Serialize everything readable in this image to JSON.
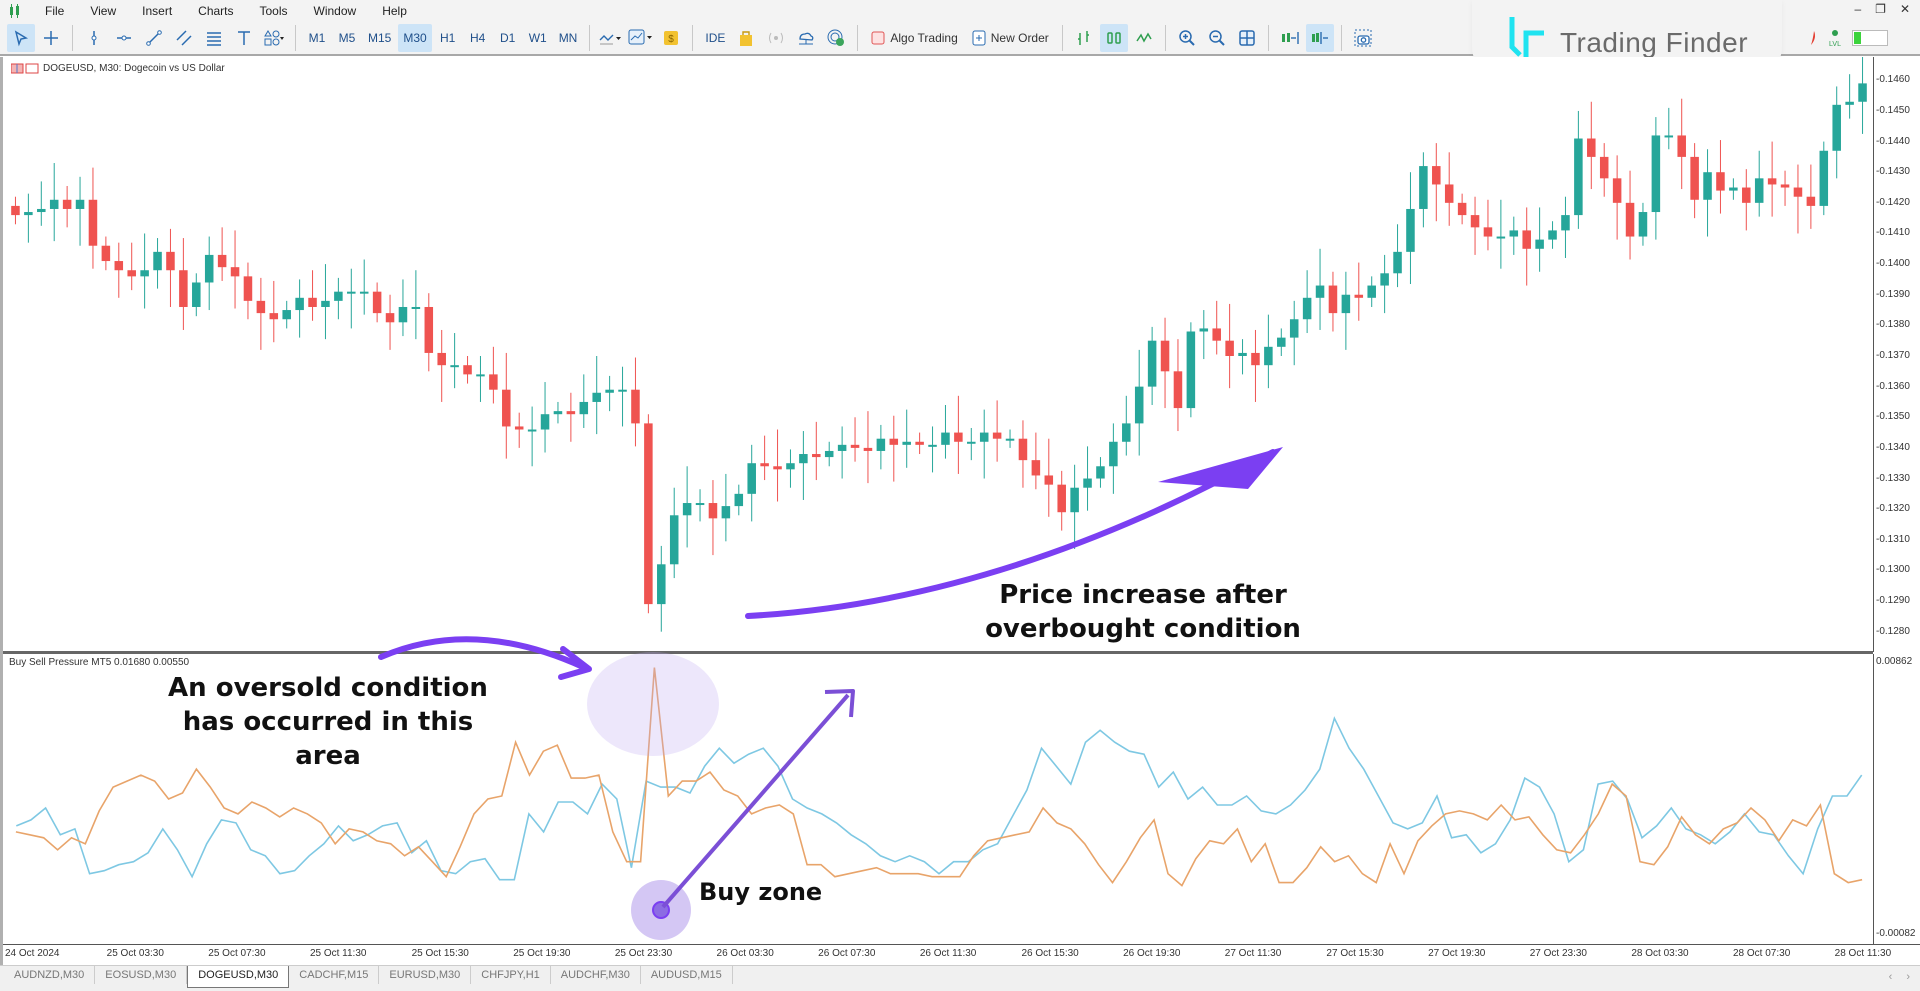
{
  "menu": {
    "items": [
      "File",
      "View",
      "Insert",
      "Charts",
      "Tools",
      "Window",
      "Help"
    ]
  },
  "window_controls": [
    "minimize-icon",
    "restore-icon",
    "close-icon"
  ],
  "toolbar": {
    "tool_icons": [
      "cursor-icon",
      "crosshair-icon",
      "vertical-line-icon",
      "horizontal-line-icon",
      "trendline-icon",
      "channel-icon",
      "fibonacci-icon",
      "text-icon",
      "shapes-icon"
    ],
    "timeframes": [
      "M1",
      "M5",
      "M15",
      "M30",
      "H1",
      "H4",
      "D1",
      "W1",
      "MN"
    ],
    "active_timeframe": "M30",
    "ide_label": "IDE",
    "algo_trading_label": "Algo Trading",
    "new_order_label": "New Order"
  },
  "logo": {
    "text": "Trading Finder",
    "accent": "#1fe3f0"
  },
  "chart": {
    "title": "DOGEUSD, M30:  Dogecoin vs US Dollar",
    "indicator_label": "Buy Sell Pressure MT5 0.01680 0.00550",
    "up_color": "#26a69a",
    "down_color": "#ef5350"
  },
  "annotations": {
    "oversold": [
      "An oversold condition",
      "has occurred in this",
      "area"
    ],
    "price_increase": [
      "Price increase after",
      "overbought condition"
    ],
    "buy_zone": "Buy zone",
    "arrow_color": "#7b3ff2"
  },
  "tabs": {
    "items": [
      "AUDNZD,M30",
      "EOSUSD,M30",
      "DOGEUSD,M30",
      "CADCHF,M15",
      "EURUSD,M30",
      "CHFJPY,H1",
      "AUDCHF,M30",
      "AUDUSD,M15"
    ],
    "active": "DOGEUSD,M30"
  },
  "chart_data": [
    {
      "type": "candlestick",
      "title": "DOGEUSD, M30: Dogecoin vs US Dollar",
      "ylim": [
        0.1275,
        0.1465
      ],
      "y_ticks": [
        "0.1460",
        "0.1450",
        "0.1440",
        "0.1430",
        "0.1420",
        "0.1410",
        "0.1400",
        "0.1390",
        "0.1380",
        "0.1370",
        "0.1360",
        "0.1350",
        "0.1340",
        "0.1330",
        "0.1320",
        "0.1310",
        "0.1300",
        "0.1290",
        "0.1280"
      ],
      "x_ticks": [
        "24 Oct 2024",
        "25 Oct 03:30",
        "25 Oct 07:30",
        "25 Oct 11:30",
        "25 Oct 15:30",
        "25 Oct 19:30",
        "25 Oct 23:30",
        "26 Oct 03:30",
        "26 Oct 07:30",
        "26 Oct 11:30",
        "26 Oct 15:30",
        "26 Oct 19:30",
        "27 Oct 11:30",
        "27 Oct 15:30",
        "27 Oct 19:30",
        "27 Oct 23:30",
        "28 Oct 03:30",
        "28 Oct 07:30",
        "28 Oct 11:30"
      ],
      "close": [
        0.1416,
        0.1417,
        0.1418,
        0.1421,
        0.1418,
        0.1421,
        0.1406,
        0.1401,
        0.1398,
        0.1396,
        0.1398,
        0.1404,
        0.1398,
        0.1386,
        0.1394,
        0.1403,
        0.1399,
        0.1396,
        0.1388,
        0.1384,
        0.1382,
        0.1385,
        0.1389,
        0.1386,
        0.1388,
        0.1391,
        0.1391,
        0.1391,
        0.1384,
        0.1381,
        0.1386,
        0.1386,
        0.1371,
        0.1367,
        0.1367,
        0.1364,
        0.1364,
        0.1359,
        0.1347,
        0.1346,
        0.1346,
        0.1351,
        0.1352,
        0.1351,
        0.1355,
        0.1358,
        0.1359,
        0.1359,
        0.1348,
        0.1289,
        0.1302,
        0.1318,
        0.1322,
        0.1322,
        0.1317,
        0.1321,
        0.1325,
        0.1335,
        0.1334,
        0.1333,
        0.1335,
        0.1338,
        0.1337,
        0.1339,
        0.1341,
        0.134,
        0.1339,
        0.1343,
        0.1341,
        0.1342,
        0.1341,
        0.1341,
        0.1345,
        0.1342,
        0.1342,
        0.1345,
        0.1343,
        0.1343,
        0.1336,
        0.1331,
        0.1328,
        0.1319,
        0.1327,
        0.133,
        0.1334,
        0.1342,
        0.1348,
        0.136,
        0.1375,
        0.1365,
        0.1353,
        0.1378,
        0.1379,
        0.1375,
        0.137,
        0.1371,
        0.1367,
        0.1373,
        0.1376,
        0.1382,
        0.1389,
        0.1393,
        0.1384,
        0.139,
        0.1389,
        0.1393,
        0.1397,
        0.1404,
        0.1418,
        0.1432,
        0.1426,
        0.142,
        0.1416,
        0.1412,
        0.1409,
        0.1409,
        0.1411,
        0.1405,
        0.1408,
        0.1411,
        0.1416,
        0.1441,
        0.1435,
        0.1428,
        0.142,
        0.1409,
        0.1417,
        0.1442,
        0.1442,
        0.1435,
        0.1421,
        0.143,
        0.1424,
        0.1425,
        0.142,
        0.1428,
        0.1426,
        0.1425,
        0.1422,
        0.1419,
        0.1437,
        0.1452,
        0.1453,
        0.1459
      ]
    },
    {
      "type": "line",
      "title": "Buy Sell Pressure MT5 0.01680 0.00550",
      "ylim": [
        -0.00082,
        0.00862
      ],
      "y_ticks": [
        "0.00862",
        "-0.00082"
      ],
      "series": [
        {
          "name": "buy_pressure",
          "color": "#7ec8e3",
          "values": [
            0.003,
            0.0032,
            0.0036,
            0.0027,
            0.0029,
            0.0014,
            0.0015,
            0.0017,
            0.0018,
            0.0021,
            0.0029,
            0.0022,
            0.0013,
            0.0024,
            0.0032,
            0.0031,
            0.0022,
            0.002,
            0.0014,
            0.0015,
            0.002,
            0.0024,
            0.003,
            0.0025,
            0.0027,
            0.003,
            0.0031,
            0.0021,
            0.0025,
            0.0015,
            0.0014,
            0.0018,
            0.0019,
            0.0012,
            0.0012,
            0.0034,
            0.0028,
            0.0038,
            0.0038,
            0.0034,
            0.0044,
            0.0039,
            0.0016,
            0.0045,
            0.0043,
            0.0043,
            0.0041,
            0.005,
            0.0056,
            0.0051,
            0.0054,
            0.0056,
            0.005,
            0.0039,
            0.0036,
            0.0034,
            0.0031,
            0.0027,
            0.0024,
            0.002,
            0.0018,
            0.002,
            0.0018,
            0.0014,
            0.0018,
            0.0018,
            0.0022,
            0.0024,
            0.0033,
            0.0042,
            0.0056,
            0.005,
            0.0044,
            0.0058,
            0.0062,
            0.0058,
            0.0055,
            0.0054,
            0.0043,
            0.0048,
            0.0039,
            0.0043,
            0.0037,
            0.0037,
            0.004,
            0.0035,
            0.0034,
            0.0037,
            0.0042,
            0.0049,
            0.0066,
            0.0056,
            0.0049,
            0.004,
            0.0031,
            0.0029,
            0.0031,
            0.004,
            0.0026,
            0.0027,
            0.0021,
            0.0024,
            0.0032,
            0.0046,
            0.0043,
            0.0034,
            0.0018,
            0.0022,
            0.0044,
            0.0045,
            0.0039,
            0.0026,
            0.003,
            0.0036,
            0.0029,
            0.0027,
            0.0024,
            0.0028,
            0.0034,
            0.0028,
            0.0027,
            0.002,
            0.0014,
            0.0029,
            0.004,
            0.004,
            0.0047
          ]
        },
        {
          "name": "sell_pressure",
          "color": "#e8a46a",
          "values": [
            0.0028,
            0.0027,
            0.0026,
            0.0022,
            0.0026,
            0.0024,
            0.0035,
            0.0043,
            0.0045,
            0.0047,
            0.0045,
            0.0039,
            0.0041,
            0.0049,
            0.0043,
            0.0036,
            0.0034,
            0.0038,
            0.0036,
            0.0033,
            0.0036,
            0.0034,
            0.0031,
            0.0024,
            0.0029,
            0.0028,
            0.0025,
            0.0024,
            0.002,
            0.0023,
            0.0018,
            0.0013,
            0.0023,
            0.0034,
            0.0039,
            0.004,
            0.0058,
            0.0047,
            0.0055,
            0.0057,
            0.0046,
            0.0046,
            0.0047,
            0.0028,
            0.0018,
            0.0018,
            0.0083,
            0.004,
            0.0045,
            0.0045,
            0.0048,
            0.0042,
            0.004,
            0.0034,
            0.0036,
            0.0037,
            0.0034,
            0.0017,
            0.0017,
            0.0013,
            0.0014,
            0.0015,
            0.0016,
            0.0014,
            0.0014,
            0.0014,
            0.0013,
            0.0013,
            0.0013,
            0.002,
            0.0025,
            0.0026,
            0.0027,
            0.0028,
            0.0036,
            0.0031,
            0.0029,
            0.0024,
            0.0017,
            0.0011,
            0.0018,
            0.0026,
            0.0032,
            0.0014,
            0.001,
            0.0019,
            0.0025,
            0.0024,
            0.0029,
            0.0018,
            0.0024,
            0.0011,
            0.0011,
            0.0016,
            0.0023,
            0.0018,
            0.002,
            0.0014,
            0.0011,
            0.0024,
            0.0014,
            0.0025,
            0.003,
            0.0034,
            0.0035,
            0.0034,
            0.0032,
            0.0037,
            0.0032,
            0.0033,
            0.0027,
            0.0022,
            0.0021,
            0.0027,
            0.0034,
            0.0044,
            0.004,
            0.0018,
            0.0017,
            0.0023,
            0.0033,
            0.0027,
            0.0024,
            0.0029,
            0.0031,
            0.0036,
            0.0032,
            0.0025,
            0.0032,
            0.003,
            0.0037,
            0.0014,
            0.0011,
            0.0012
          ]
        }
      ]
    }
  ]
}
